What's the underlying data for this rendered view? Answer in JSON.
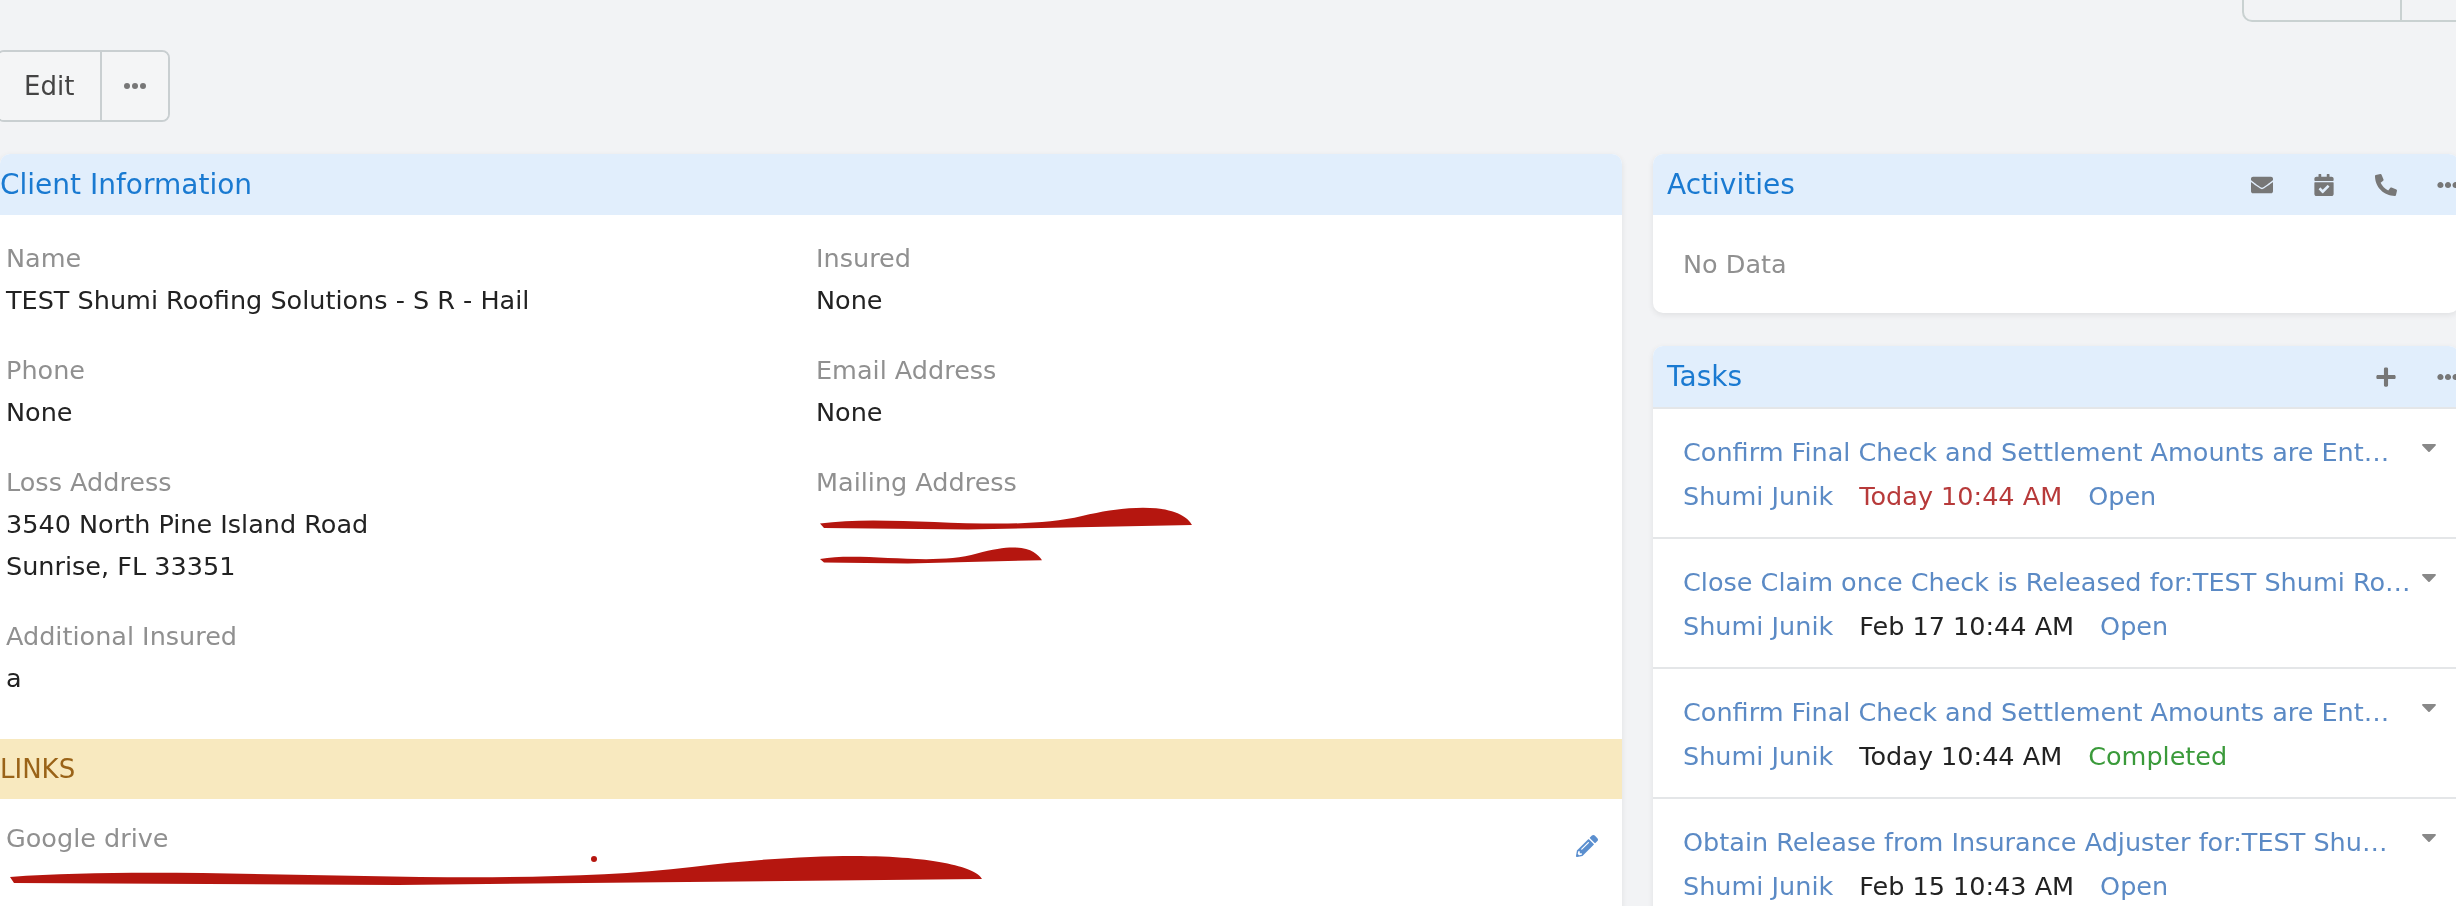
{
  "toolbar": {
    "edit_label": "Edit"
  },
  "client_information": {
    "title": "Client Information",
    "fields": [
      {
        "label": "Name",
        "lines": [
          "TEST Shumi Roofing Solutions - S R - Hail"
        ],
        "redacted": false
      },
      {
        "label": "Insured",
        "lines": [
          "None"
        ],
        "redacted": false
      },
      {
        "label": "Phone",
        "lines": [
          "None"
        ],
        "redacted": false
      },
      {
        "label": "Email Address",
        "lines": [
          "None"
        ],
        "redacted": false
      },
      {
        "label": "Loss Address",
        "lines": [
          "3540 North Pine Island Road",
          "Sunrise, FL 33351"
        ],
        "redacted": false
      },
      {
        "label": "Mailing Address",
        "redacted": true
      },
      {
        "label": "Additional Insured",
        "lines": [
          "a"
        ],
        "redacted": false
      }
    ],
    "links_title": "LINKS",
    "links": [
      {
        "label": "Google drive",
        "redacted": true
      }
    ]
  },
  "activities": {
    "title": "Activities",
    "empty_text": "No Data"
  },
  "tasks": {
    "title": "Tasks",
    "items": [
      {
        "title": "Confirm Final Check and Settlement Amounts are Ent…",
        "assignee": "Shumi Junik",
        "due": "Today 10:44 AM",
        "overdue": true,
        "status": "Open",
        "completed": false
      },
      {
        "title": "Close Claim once Check is Released for:TEST Shumi Ro…",
        "assignee": "Shumi Junik",
        "due": "Feb 17 10:44 AM",
        "overdue": false,
        "status": "Open",
        "completed": false
      },
      {
        "title": "Confirm Final Check and Settlement Amounts are Ent…",
        "assignee": "Shumi Junik",
        "due": "Today 10:44 AM",
        "overdue": false,
        "status": "Completed",
        "completed": true
      },
      {
        "title": "Obtain Release from Insurance Adjuster for:TEST Shu…",
        "assignee": "Shumi Junik",
        "due": "Feb 15 10:43 AM",
        "overdue": false,
        "status": "Open",
        "completed": false
      }
    ]
  }
}
